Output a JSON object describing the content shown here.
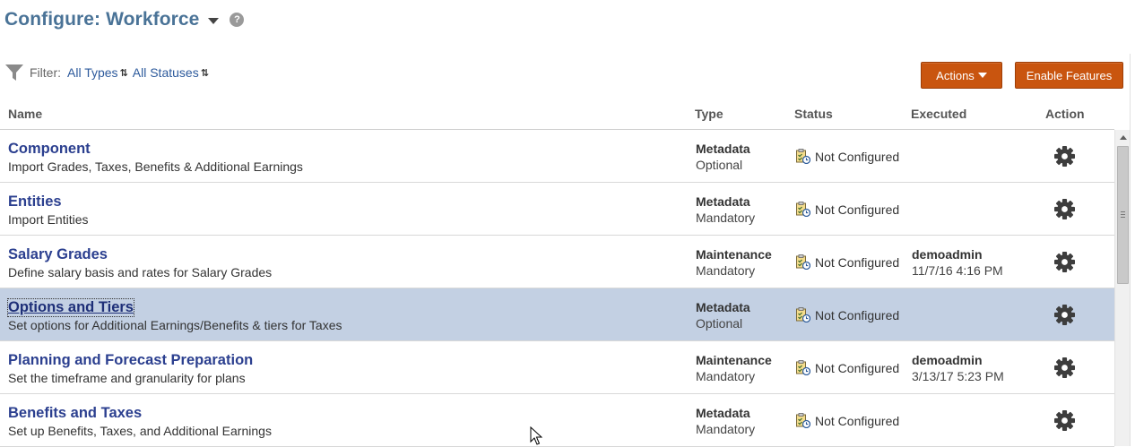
{
  "header": {
    "title": "Configure: Workforce",
    "help_glyph": "?",
    "icons": [
      "chevron-down-icon",
      "help-icon"
    ]
  },
  "filter": {
    "label": "Filter:",
    "types": "All Types",
    "statuses": "All Statuses",
    "swap_glyph": "⇅"
  },
  "buttons": {
    "actions": "Actions",
    "enable": "Enable Features",
    "color": "#c9550f"
  },
  "columns": {
    "name": "Name",
    "type": "Type",
    "status": "Status",
    "executed": "Executed",
    "action": "Action"
  },
  "rows": [
    {
      "name": "Component",
      "desc": "Import Grades, Taxes, Benefits & Additional Earnings",
      "type": "Metadata",
      "req": "Optional",
      "status": "Not Configured",
      "user": "",
      "date": ""
    },
    {
      "name": "Entities",
      "desc": "Import Entities",
      "type": "Metadata",
      "req": "Mandatory",
      "status": "Not Configured",
      "user": "",
      "date": ""
    },
    {
      "name": "Salary Grades",
      "desc": "Define salary basis and rates for Salary Grades",
      "type": "Maintenance",
      "req": "Mandatory",
      "status": "Not Configured",
      "user": "demoadmin",
      "date": "11/7/16 4:16 PM"
    },
    {
      "name": "Options and Tiers",
      "desc": "Set options for Additional Earnings/Benefits & tiers for Taxes",
      "type": "Metadata",
      "req": "Optional",
      "status": "Not Configured",
      "user": "",
      "date": "",
      "selected": true
    },
    {
      "name": "Planning and Forecast Preparation",
      "desc": "Set the timeframe and granularity for plans",
      "type": "Maintenance",
      "req": "Mandatory",
      "status": "Not Configured",
      "user": "demoadmin",
      "date": "3/13/17 5:23 PM"
    },
    {
      "name": "Benefits and Taxes",
      "desc": "Set up Benefits, Taxes, and Additional Earnings",
      "type": "Metadata",
      "req": "Mandatory",
      "status": "Not Configured",
      "user": "",
      "date": ""
    }
  ],
  "colors": {
    "title": "#4a7397",
    "link": "#2b3f8f",
    "selected_row": "#c3d0e3"
  }
}
